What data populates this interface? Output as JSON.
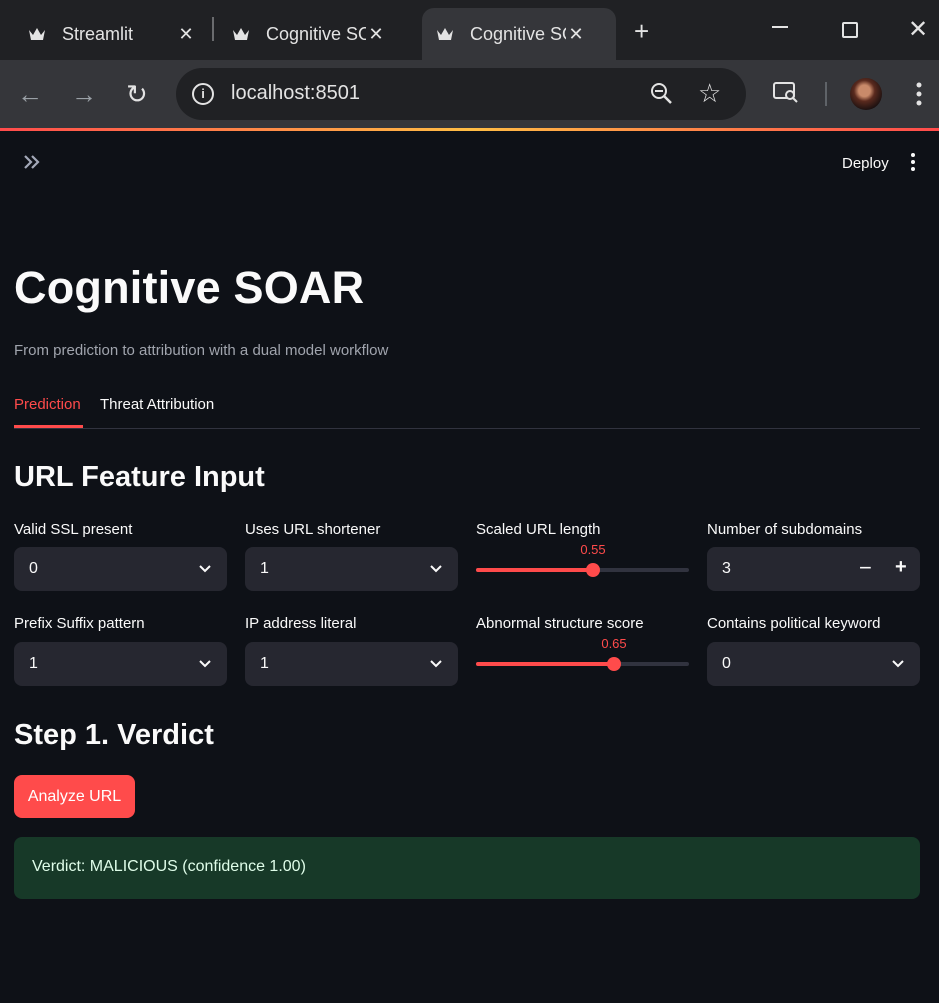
{
  "browser": {
    "tabs": [
      {
        "title": "Streamlit",
        "active": false
      },
      {
        "title": "Cognitive SOAR",
        "active": false
      },
      {
        "title": "Cognitive SOAR",
        "active": true
      }
    ],
    "url": "localhost:8501"
  },
  "header": {
    "deploy_label": "Deploy"
  },
  "page": {
    "title": "Cognitive SOAR",
    "caption": "From prediction to attribution with a dual model workflow",
    "tabs": [
      "Prediction",
      "Threat Attribution"
    ],
    "active_tab": "Prediction"
  },
  "feature_section": {
    "heading": "URL Feature Input",
    "row1": {
      "valid_ssl": {
        "label": "Valid SSL present",
        "value": "0"
      },
      "url_shortener": {
        "label": "Uses URL shortener",
        "value": "1"
      },
      "url_length": {
        "label": "Scaled URL length",
        "value": "0.55",
        "level": 0.55
      },
      "subdomains": {
        "label": "Number of subdomains",
        "value": "3"
      }
    },
    "row2": {
      "prefix_suffix": {
        "label": "Prefix Suffix pattern",
        "value": "1"
      },
      "ip_literal": {
        "label": "IP address literal",
        "value": "1"
      },
      "abnormal_structure": {
        "label": "Abnormal structure score",
        "value": "0.65",
        "level": 0.65
      },
      "political_keyword": {
        "label": "Contains political keyword",
        "value": "0"
      }
    }
  },
  "verdict_section": {
    "heading": "Step 1. Verdict",
    "button_label": "Analyze URL",
    "result": "Verdict: MALICIOUS (confidence 1.00)"
  },
  "colors": {
    "accent": "#ff4b4b",
    "background": "#0e1117",
    "widget_bg": "#262730",
    "success_bg": "#173928"
  }
}
